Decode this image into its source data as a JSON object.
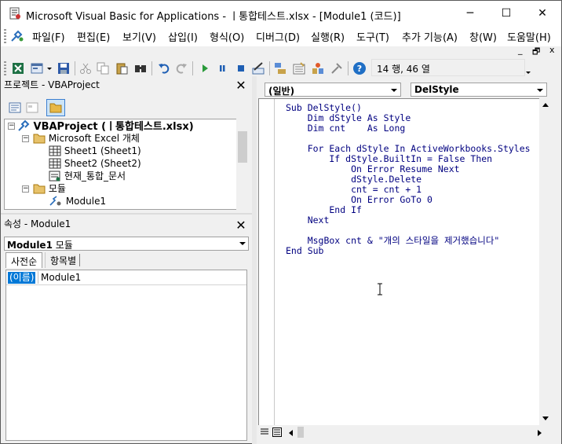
{
  "window": {
    "title": "Microsoft Visual Basic for Applications - ㅣ통합테스트.xlsx - [Module1 (코드)]",
    "minimize_glyph": "─",
    "maximize_glyph": "☐",
    "close_glyph": "✕"
  },
  "menu": {
    "items": [
      "파일(F)",
      "편집(E)",
      "보기(V)",
      "삽입(I)",
      "형식(O)",
      "디버그(D)",
      "실행(R)",
      "도구(T)",
      "추가 기능(A)",
      "창(W)",
      "도움말(H)"
    ],
    "mdi_minimize": "_",
    "mdi_restore": "🗗",
    "mdi_close": "x"
  },
  "toolbar": {
    "status": "14 행, 46 열"
  },
  "project_pane": {
    "title": "프로젝트 - VBAProject",
    "close_label": "✕",
    "tree": {
      "root": "VBAProject (ㅣ통합테스트.xlsx)",
      "excel_objects_folder": "Microsoft Excel 개체",
      "sheet1": "Sheet1 (Sheet1)",
      "sheet2": "Sheet2 (Sheet2)",
      "thisworkbook": "현재_통합_문서",
      "modules_folder": "모듈",
      "module1": "Module1"
    }
  },
  "properties_pane": {
    "title": "속성 - Module1",
    "close_label": "✕",
    "object_name": "Module1",
    "object_type": "모듈",
    "tabs": [
      "사전순",
      "항목별"
    ],
    "grid": {
      "name_key": "(이름)",
      "name_value": "Module1"
    }
  },
  "code_window": {
    "object_combo": "(일반)",
    "procedure_combo": "DelStyle",
    "lines": [
      "Sub DelStyle()",
      "    Dim dStyle As Style",
      "    Dim cnt    As Long",
      "",
      "    For Each dStyle In ActiveWorkbooks.Styles",
      "        If dStyle.BuiltIn = False Then",
      "            On Error Resume Next",
      "            dStyle.Delete",
      "            cnt = cnt + 1",
      "            On Error GoTo 0",
      "        End If",
      "    Next",
      "",
      "    MsgBox cnt & \"개의 스타일을 제거했습니다\"",
      "End Sub"
    ]
  },
  "colors": {
    "code_text": "#000080",
    "selection_bg": "#0078d7",
    "chrome": "#f0f0f0"
  }
}
